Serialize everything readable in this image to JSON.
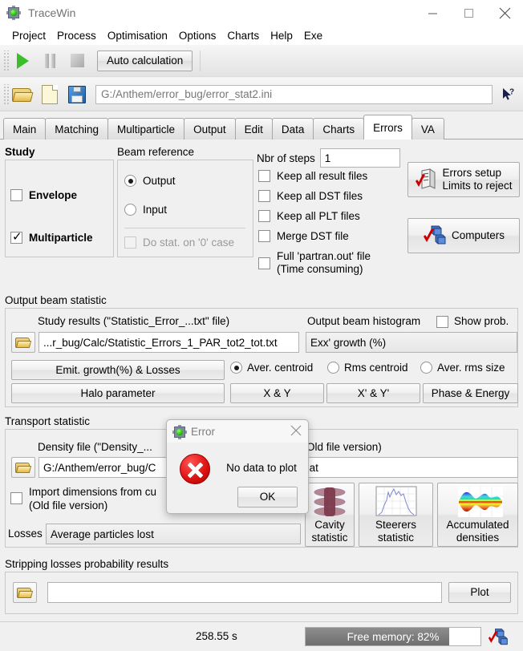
{
  "window": {
    "title": "TraceWin",
    "app_icon": "tracewin-icon",
    "minimize": "minimize-icon",
    "maximize": "maximize-icon",
    "close": "close-icon"
  },
  "menubar": {
    "items": [
      "Project",
      "Process",
      "Optimisation",
      "Options",
      "Charts",
      "Help",
      "Exe"
    ]
  },
  "toolbar": {
    "run_icon": "play-icon",
    "pause_icon": "pause-icon",
    "stop_icon": "stop-icon",
    "auto_calculation_label": "Auto calculation",
    "open_icon": "open-folder-icon",
    "new_icon": "new-document-icon",
    "save_icon": "save-icon",
    "help_icon": "whats-this-help-icon",
    "project_path": "G:/Anthem/error_bug/error_stat2.ini"
  },
  "tabs": {
    "items": [
      "Main",
      "Matching",
      "Multiparticle",
      "Output",
      "Edit",
      "Data",
      "Charts",
      "Errors",
      "VA"
    ],
    "active": "Errors"
  },
  "study": {
    "group_label": "Study",
    "envelope_label": "Envelope",
    "envelope_checked": false,
    "multiparticle_label": "Multiparticle",
    "multiparticle_checked": true
  },
  "beam_reference": {
    "group_label": "Beam reference",
    "output_label": "Output",
    "input_label": "Input",
    "selected": "Output",
    "do_stat_label": "Do stat. on '0' case",
    "do_stat_checked": false,
    "do_stat_disabled": true
  },
  "steps": {
    "label": "Nbr of steps",
    "value": "1",
    "options": [
      {
        "label": "Keep all result files",
        "checked": false
      },
      {
        "label": "Keep all DST  files",
        "checked": false
      },
      {
        "label": "Keep all PLT  files",
        "checked": false
      },
      {
        "label": "Merge DST  file",
        "checked": false
      }
    ],
    "partran_line1": "Full 'partran.out' file",
    "partran_line2": "(Time consuming)",
    "partran_checked": false
  },
  "side_buttons": {
    "errors_setup_line1": "Errors setup",
    "errors_setup_line2": "Limits to reject",
    "errors_setup_icon": "errors-setup-icon",
    "computers_label": "Computers",
    "computers_icon": "computers-icon"
  },
  "output_beam_statistic": {
    "group_label": "Output beam statistic",
    "study_results_label": "Study results (\"Statistic_Error_...txt\"  file)",
    "study_results_path": "...r_bug/Calc/Statistic_Errors_1_PAR_tot2_tot.txt",
    "browse_icon": "open-folder-icon",
    "histogram_label": "Output beam histogram",
    "show_prob_label": "Show prob.",
    "show_prob_checked": false,
    "histogram_value": "Εxx' growth (%)",
    "emit_growth_label": "Emit. growth(%) & Losses",
    "halo_label": "Halo parameter",
    "radios": [
      {
        "label": "Aver. centroid",
        "selected": true
      },
      {
        "label": "Rms centroid",
        "selected": false
      },
      {
        "label": "Aver. rms size",
        "selected": false
      }
    ],
    "xy_label": "X & Y",
    "xpyp_label": "X' & Y'",
    "phase_energy_label": "Phase & Energy"
  },
  "transport_statistic": {
    "group_label": "Transport statistic",
    "density_label": "Density file (\"Density_...",
    "density_label_full": "Density file (\"Density_...",
    "old_file_version_label": "Old file version)",
    "density_path": "G:/Anthem/error_bug/C",
    "density_path_right": "0000.dat",
    "browse_icon": "open-folder-icon",
    "import_line1": "Import dimensions from cu",
    "import_line2": "(Old file version)",
    "import_checked": false,
    "losses_label": "Losses",
    "losses_value": "Average particles lost",
    "cavity_line1": "Cavity",
    "cavity_line2": "statistic",
    "cavity_icon": "cavity-statistic-thumbnail-icon",
    "steerers_line1": "Steerers",
    "steerers_line2": "statistic",
    "steerers_icon": "steerers-statistic-thumbnail-icon",
    "densities_line1": "Accumulated",
    "densities_line2": "densities",
    "densities_icon": "accumulated-densities-thumbnail-icon"
  },
  "stripping": {
    "group_label": "Stripping losses probability results",
    "path_value": "",
    "browse_icon": "open-folder-icon",
    "plot_label": "Plot"
  },
  "statusbar": {
    "time": "258.55 s",
    "memory_label": "Free memory: 82%",
    "memory_percent": 82,
    "status_icon": "computers-icon"
  },
  "error_dialog": {
    "title": "Error",
    "app_icon": "tracewin-icon",
    "close_icon": "close-icon",
    "error_icon": "error-cross-icon",
    "message": "No data to plot",
    "ok_label": "OK"
  },
  "colors": {
    "accent_green": "#3bbf28",
    "error_red": "#e01414",
    "window_bg": "#f0f0f0",
    "panel_border": "#c8c8c8"
  }
}
